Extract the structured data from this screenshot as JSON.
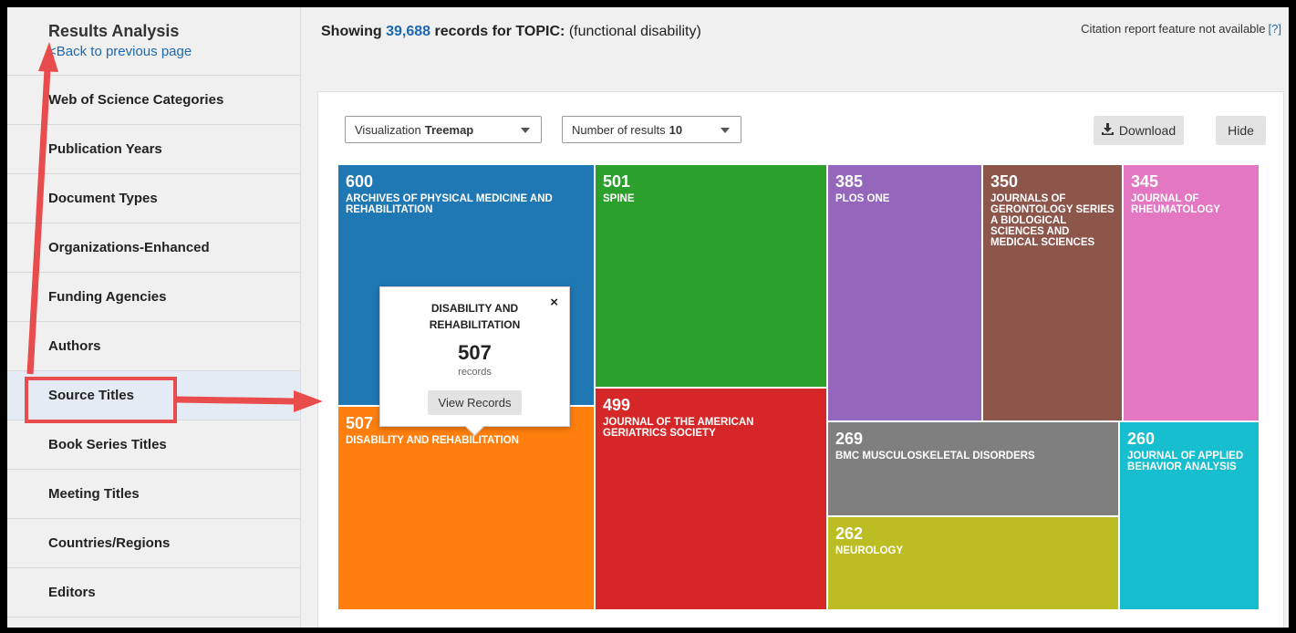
{
  "sidebar": {
    "title": "Results Analysis",
    "back": "<Back to previous page",
    "items": [
      {
        "label": "Web of Science Categories"
      },
      {
        "label": "Publication Years"
      },
      {
        "label": "Document Types"
      },
      {
        "label": "Organizations-Enhanced"
      },
      {
        "label": "Funding Agencies"
      },
      {
        "label": "Authors"
      },
      {
        "label": "Source Titles"
      },
      {
        "label": "Book Series Titles"
      },
      {
        "label": "Meeting Titles"
      },
      {
        "label": "Countries/Regions"
      },
      {
        "label": "Editors"
      }
    ],
    "active": "Source Titles"
  },
  "header": {
    "showing_prefix": "Showing",
    "count": "39,688",
    "records_for": "records for",
    "topic_label": "TOPIC:",
    "topic_value": "(functional disability)",
    "citation_note": "Citation report feature not available",
    "citation_help": "[?]"
  },
  "controls": {
    "visualization_label": "Visualization",
    "visualization_value": "Treemap",
    "results_label": "Number of results",
    "results_value": "10",
    "download_label": "Download",
    "hide_label": "Hide"
  },
  "treemap": {
    "tiles": [
      {
        "value": "600",
        "label": "ARCHIVES OF PHYSICAL MEDICINE AND REHABILITATION",
        "color": "#1f77b4"
      },
      {
        "value": "501",
        "label": "SPINE",
        "color": "#2ca02c"
      },
      {
        "value": "385",
        "label": "PLOS ONE",
        "color": "#9467bd"
      },
      {
        "value": "350",
        "label": "JOURNALS OF GERONTOLOGY SERIES A BIOLOGICAL SCIENCES AND MEDICAL SCIENCES",
        "color": "#8c564b"
      },
      {
        "value": "345",
        "label": "JOURNAL OF RHEUMATOLOGY",
        "color": "#e377c2"
      },
      {
        "value": "507",
        "label": "DISABILITY AND REHABILITATION",
        "color": "#ff7f0e"
      },
      {
        "value": "499",
        "label": "JOURNAL OF THE AMERICAN GERIATRICS SOCIETY",
        "color": "#d62728"
      },
      {
        "value": "269",
        "label": "BMC MUSCULOSKELETAL DISORDERS",
        "color": "#7f7f7f"
      },
      {
        "value": "260",
        "label": "JOURNAL OF APPLIED BEHAVIOR ANALYSIS",
        "color": "#17becf"
      },
      {
        "value": "262",
        "label": "NEUROLOGY",
        "color": "#bcbd22"
      }
    ]
  },
  "tooltip": {
    "title": "DISABILITY AND REHABILITATION",
    "count": "507",
    "unit": "records",
    "button": "View Records",
    "close": "×"
  },
  "annotation_color": "#e84c4c"
}
